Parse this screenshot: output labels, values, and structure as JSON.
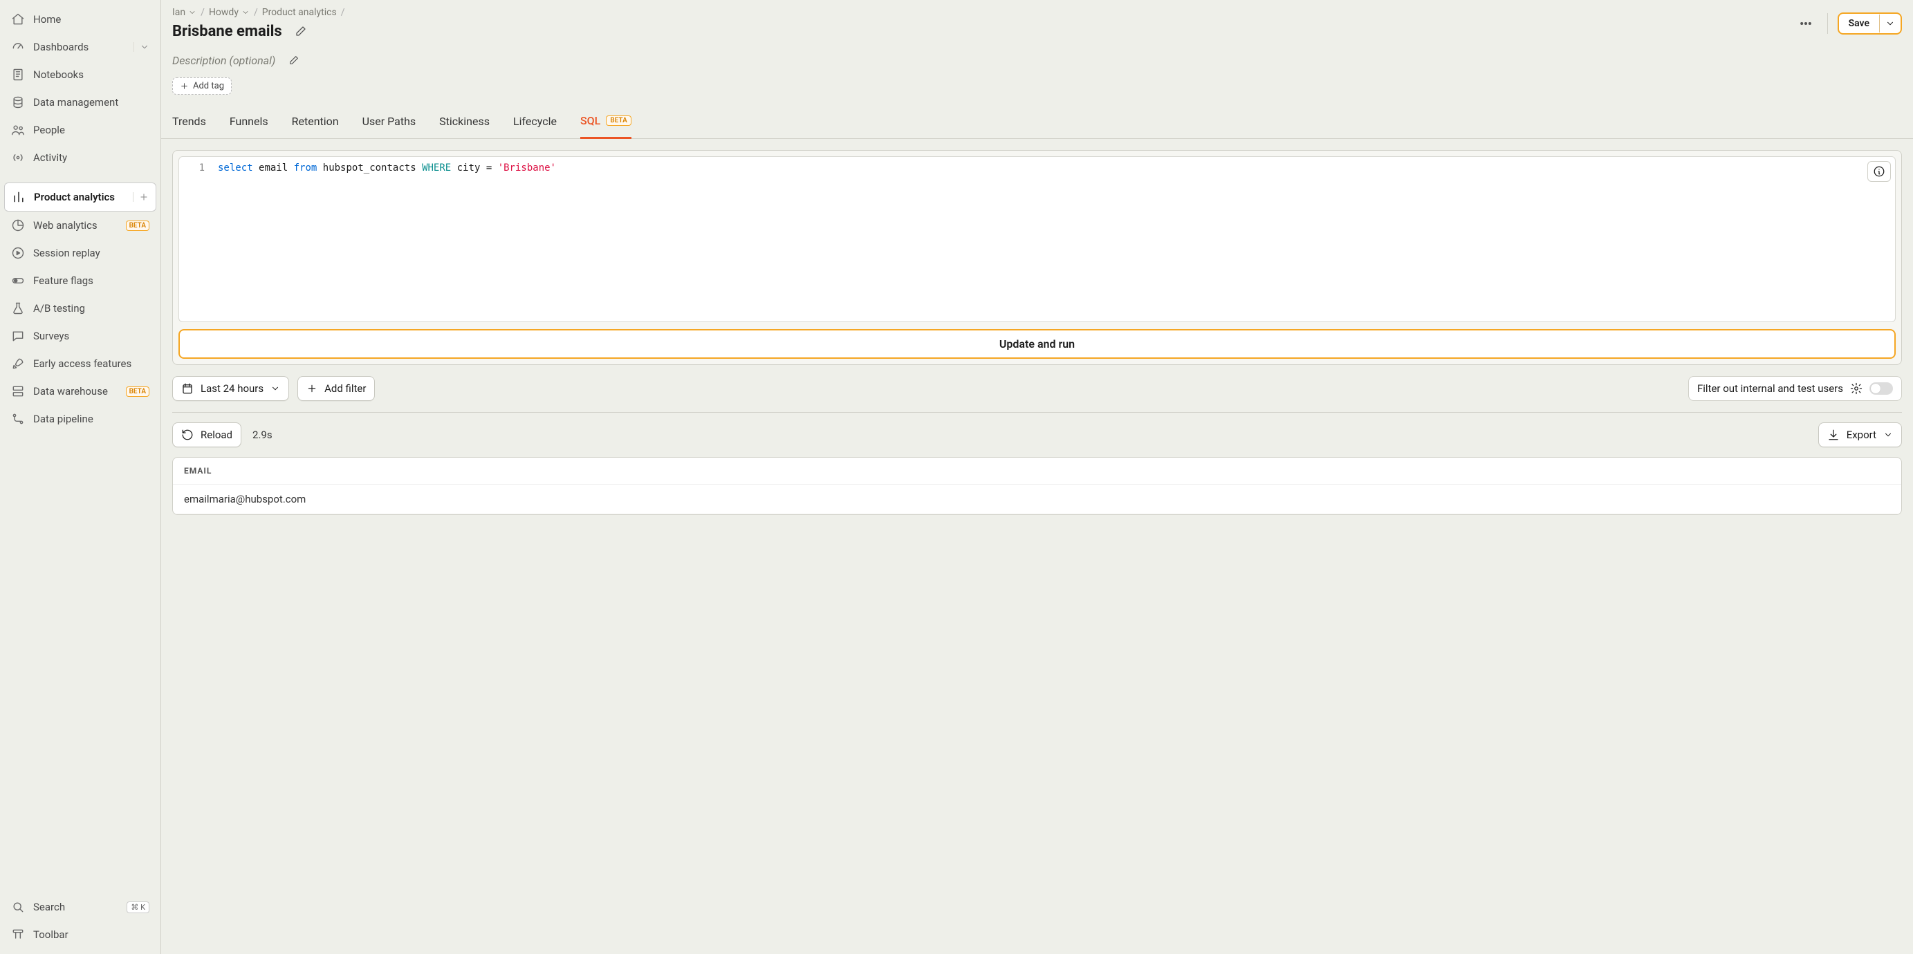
{
  "sidebar": {
    "items": [
      {
        "label": "Home"
      },
      {
        "label": "Dashboards"
      },
      {
        "label": "Notebooks"
      },
      {
        "label": "Data management"
      },
      {
        "label": "People"
      },
      {
        "label": "Activity"
      },
      {
        "label": "Product analytics"
      },
      {
        "label": "Web analytics",
        "badge": "BETA"
      },
      {
        "label": "Session replay"
      },
      {
        "label": "Feature flags"
      },
      {
        "label": "A/B testing"
      },
      {
        "label": "Surveys"
      },
      {
        "label": "Early access features"
      },
      {
        "label": "Data warehouse",
        "badge": "BETA"
      },
      {
        "label": "Data pipeline"
      }
    ],
    "search": "Search",
    "search_kbd": "⌘ K",
    "toolbar": "Toolbar"
  },
  "breadcrumbs": [
    {
      "label": "Ian"
    },
    {
      "label": "Howdy"
    },
    {
      "label": "Product analytics"
    }
  ],
  "title": "Brisbane emails",
  "save_label": "Save",
  "description_placeholder": "Description (optional)",
  "add_tag": "Add tag",
  "tabs": [
    {
      "label": "Trends"
    },
    {
      "label": "Funnels"
    },
    {
      "label": "Retention"
    },
    {
      "label": "User Paths"
    },
    {
      "label": "Stickiness"
    },
    {
      "label": "Lifecycle"
    },
    {
      "label": "SQL",
      "badge": "BETA",
      "active": true
    }
  ],
  "sql": {
    "line_number": "1",
    "tokens": {
      "select": "select",
      "email": "email",
      "from": "from",
      "table": "hubspot_contacts",
      "where": "WHERE",
      "city": "city",
      "eq": "=",
      "value": "'Brisbane'"
    }
  },
  "run_label": "Update and run",
  "date_range": "Last 24 hours",
  "add_filter": "Add filter",
  "filter_toggle": "Filter out internal and test users",
  "reload": "Reload",
  "query_time": "2.9s",
  "export": "Export",
  "table": {
    "columns": [
      "EMAIL"
    ],
    "rows": [
      [
        "emailmaria@hubspot.com"
      ]
    ]
  }
}
